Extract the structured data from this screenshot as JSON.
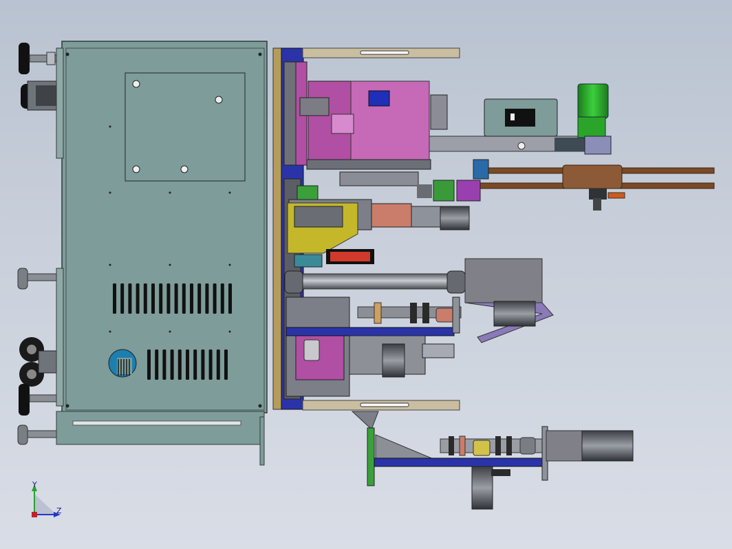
{
  "viewport": {
    "background_top": "#b9c2d0",
    "background_bottom": "#d9dde6"
  },
  "triad": {
    "y_label": "Y",
    "z_label": "Z",
    "y_color": "#27a327",
    "z_color": "#2236c8"
  },
  "colors": {
    "cabinet": "#7e9c99",
    "cabinet_edge": "#3e4f4e",
    "tan_rail": "#c9bea0",
    "navy": "#2a34a8",
    "magenta": "#b04fa3",
    "green_motor": "#2aa52a",
    "gray_motor": "#7a7d84",
    "yellow_plate": "#c4b82a",
    "salmon": "#c97d6a",
    "belt": "#7a4a26",
    "black": "#111111"
  }
}
